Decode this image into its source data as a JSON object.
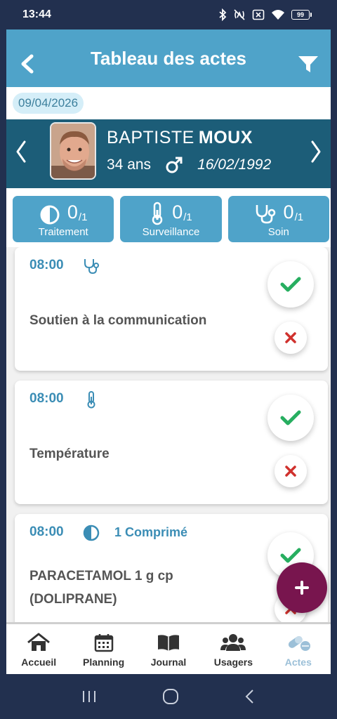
{
  "status_bar": {
    "time": "13:44",
    "battery": "99"
  },
  "header": {
    "title": "Tableau des actes"
  },
  "date": "09/04/2026",
  "patient": {
    "first_name": "BAPTISTE",
    "last_name": "MOUX",
    "age": "34 ans",
    "dob": "16/02/1992",
    "gender_icon": "male-icon"
  },
  "categories": [
    {
      "count": "0",
      "total": "/1",
      "label": "Traitement",
      "icon": "half-circle-icon"
    },
    {
      "count": "0",
      "total": "/1",
      "label": "Surveillance",
      "icon": "thermometer-icon"
    },
    {
      "count": "0",
      "total": "/1",
      "label": "Soin",
      "icon": "stethoscope-icon"
    }
  ],
  "acts": [
    {
      "time": "08:00",
      "icon": "stethoscope-icon",
      "quantity": "",
      "label": "Soutien à la communication"
    },
    {
      "time": "08:00",
      "icon": "thermometer-icon",
      "quantity": "",
      "label": "Température"
    },
    {
      "time": "08:00",
      "icon": "half-circle-icon",
      "quantity": "1 Comprimé",
      "label_line1": "PARACETAMOL 1 g cp",
      "label_line2": "(DOLIPRANE)"
    }
  ],
  "colors": {
    "header": "#4fa3c9",
    "patient_bar": "#1c5d78",
    "accent_text": "#3b8db5",
    "validate": "#27ae60",
    "cancel": "#d0312d",
    "fab": "#78154e",
    "active_tab": "#9cc0d8"
  },
  "bottom_nav": [
    {
      "label": "Accueil",
      "icon": "home-icon"
    },
    {
      "label": "Planning",
      "icon": "calendar-icon"
    },
    {
      "label": "Journal",
      "icon": "book-icon"
    },
    {
      "label": "Usagers",
      "icon": "users-icon"
    },
    {
      "label": "Actes",
      "icon": "pills-icon",
      "active": true
    }
  ]
}
